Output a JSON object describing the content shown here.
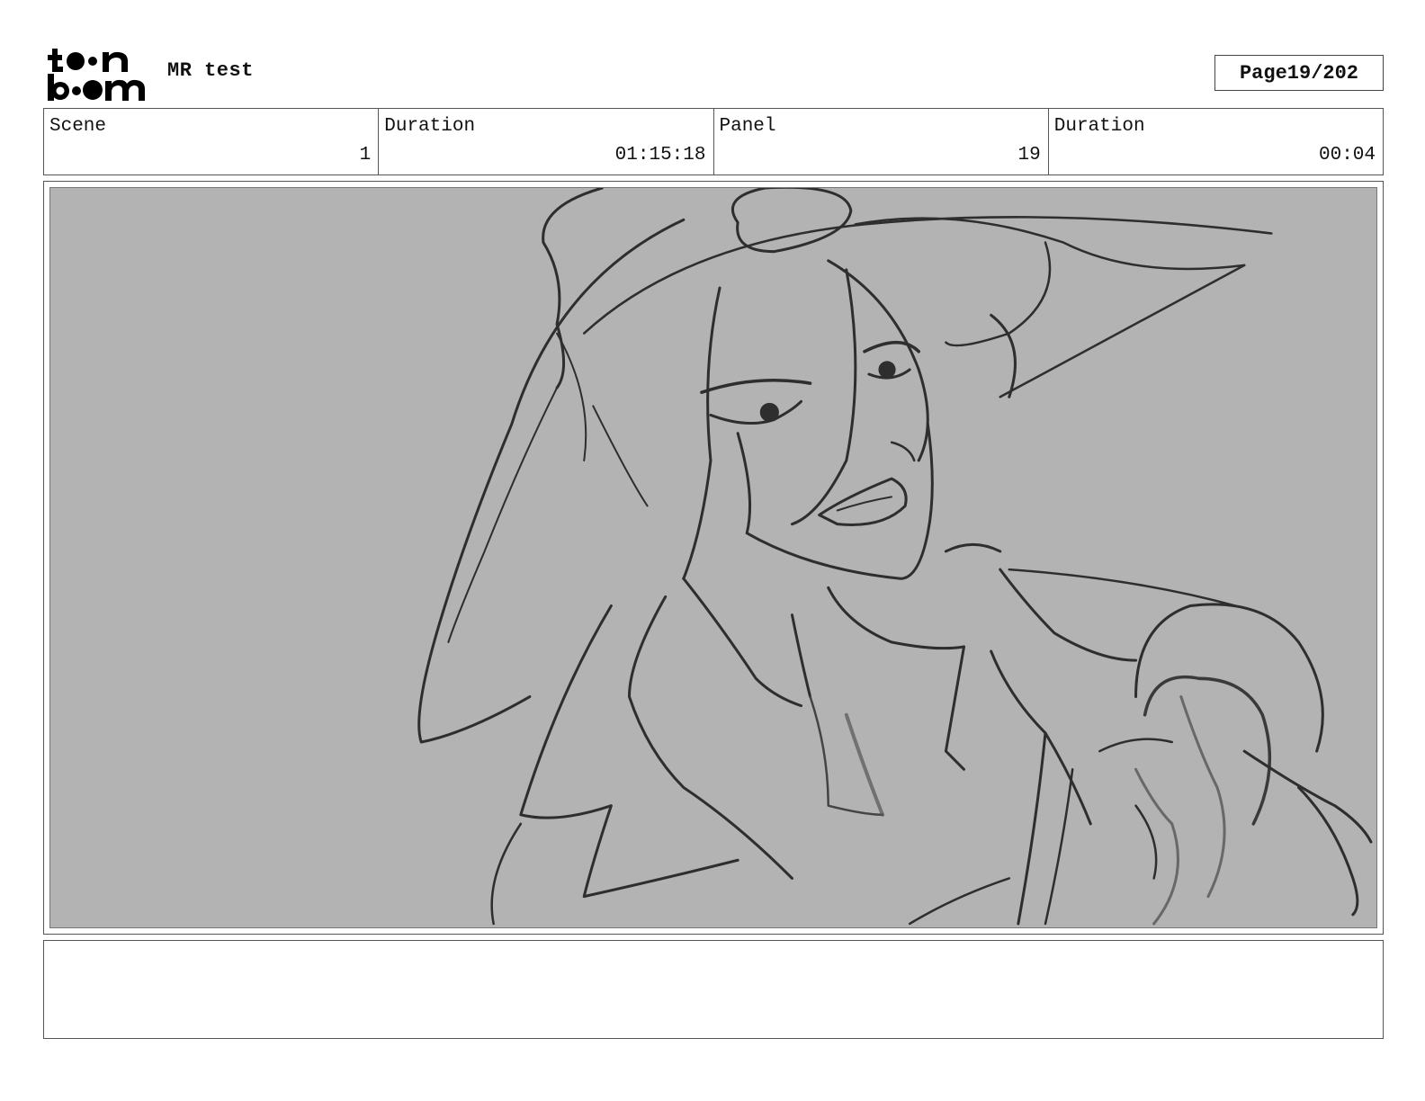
{
  "header": {
    "logo_text_top": "toon",
    "logo_text_bottom": "boom",
    "project_title": "MR test",
    "page_label": "Page",
    "page_value": "19/202"
  },
  "info": {
    "scene_label": "Scene",
    "scene_value": "1",
    "scene_duration_label": "Duration",
    "scene_duration_value": "01:15:18",
    "panel_label": "Panel",
    "panel_value": "19",
    "panel_duration_label": "Duration",
    "panel_duration_value": "00:04"
  },
  "panel": {
    "image": "sketch of a witch character in a large pointed hat with clenched teeth, reaching forward",
    "background_color": "#b3b3b3"
  },
  "notes": {
    "text": ""
  }
}
